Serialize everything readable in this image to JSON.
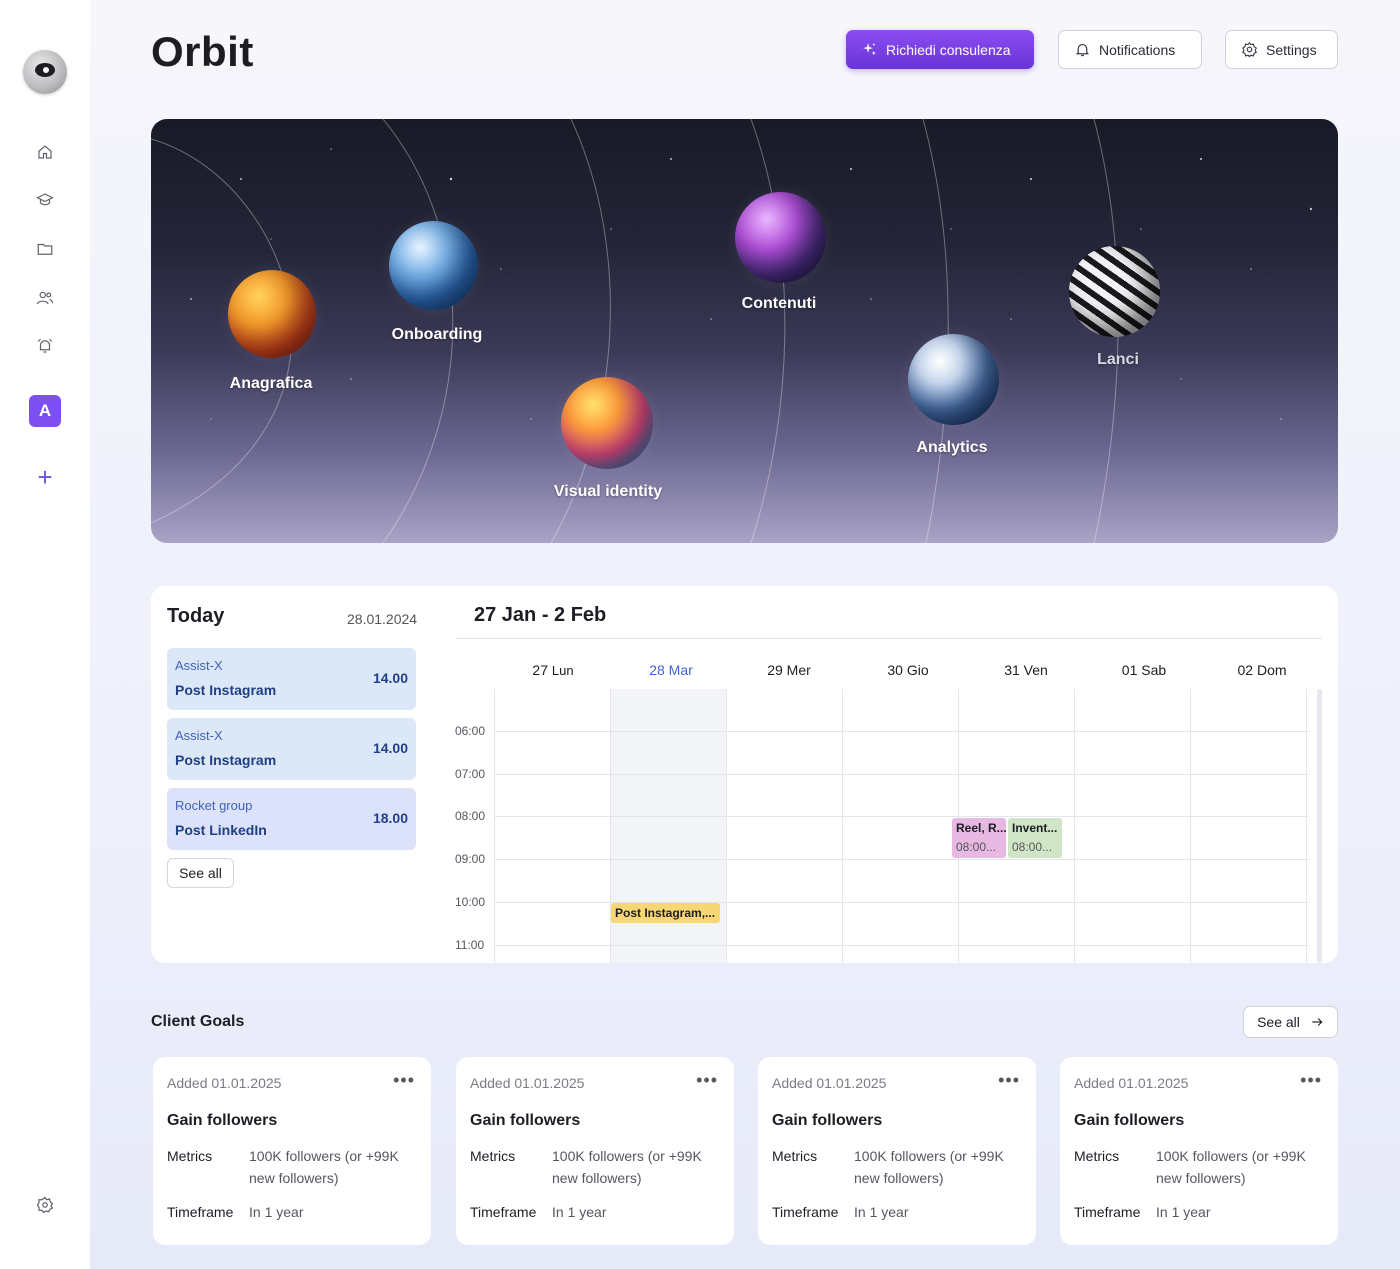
{
  "app": {
    "title": "Orbit"
  },
  "header": {
    "consult_label": "Richiedi consulenza",
    "notifications_label": "Notifications",
    "settings_label": "Settings"
  },
  "sidebar": {
    "badge_letter": "A",
    "items": [
      {
        "icon": "home-icon"
      },
      {
        "icon": "graduation-cap-icon"
      },
      {
        "icon": "folder-icon"
      },
      {
        "icon": "users-icon"
      },
      {
        "icon": "alarm-icon"
      }
    ],
    "add_label": "+"
  },
  "hero": {
    "planets": [
      {
        "label": "Anagrafica"
      },
      {
        "label": "Onboarding"
      },
      {
        "label": "Visual identity"
      },
      {
        "label": "Contenuti"
      },
      {
        "label": "Analytics"
      },
      {
        "label": "Lanci"
      }
    ]
  },
  "today": {
    "title": "Today",
    "date": "28.01.2024",
    "events": [
      {
        "client": "Assist-X",
        "title": "Post Instagram",
        "time": "14.00"
      },
      {
        "client": "Assist-X",
        "title": "Post Instagram",
        "time": "14.00"
      },
      {
        "client": "Rocket group",
        "title": "Post LinkedIn",
        "time": "18.00"
      }
    ],
    "see_all": "See all"
  },
  "week": {
    "title": "27 Jan - 2 Feb",
    "days": [
      {
        "num": "27",
        "name": "Lun"
      },
      {
        "num": "28",
        "name": "Mar"
      },
      {
        "num": "29",
        "name": "Mer"
      },
      {
        "num": "30",
        "name": "Gio"
      },
      {
        "num": "31",
        "name": "Ven"
      },
      {
        "num": "01",
        "name": "Sab"
      },
      {
        "num": "02",
        "name": "Dom"
      }
    ],
    "times": [
      "06:00",
      "07:00",
      "08:00",
      "09:00",
      "10:00",
      "11:00"
    ],
    "events": [
      {
        "title": "Reel, R...",
        "sub": "08:00...",
        "color": "#e7b9e2"
      },
      {
        "title": "Invent...",
        "sub": "08:00...",
        "color": "#cfe5c6"
      },
      {
        "title": "Post Instagram,...",
        "color": "#f6d774"
      }
    ]
  },
  "goals": {
    "title": "Client Goals",
    "see_all": "See all",
    "cards": [
      {
        "added": "Added 01.01.2025",
        "name": "Gain followers",
        "metrics_label": "Metrics",
        "metrics_value": "100K followers (or +99K new followers)",
        "timeframe_label": "Timeframe",
        "timeframe_value": "In 1 year"
      },
      {
        "added": "Added 01.01.2025",
        "name": "Gain followers",
        "metrics_label": "Metrics",
        "metrics_value": "100K followers (or +99K new followers)",
        "timeframe_label": "Timeframe",
        "timeframe_value": "In 1 year"
      },
      {
        "added": "Added 01.01.2025",
        "name": "Gain followers",
        "metrics_label": "Metrics",
        "metrics_value": "100K followers (or +99K new followers)",
        "timeframe_label": "Timeframe",
        "timeframe_value": "In 1 year"
      },
      {
        "added": "Added 01.01.2025",
        "name": "Gain followers",
        "metrics_label": "Metrics",
        "metrics_value": "100K followers (or +99K new followers)",
        "timeframe_label": "Timeframe",
        "timeframe_value": "In 1 year"
      }
    ]
  }
}
